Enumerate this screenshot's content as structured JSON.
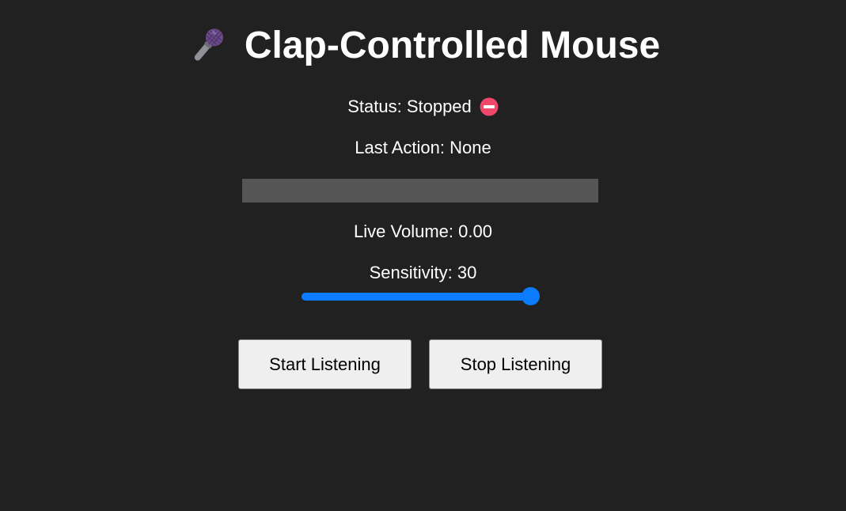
{
  "header": {
    "icon": "microphone-icon",
    "title": "Clap-Controlled Mouse"
  },
  "status": {
    "text": "Status: Stopped",
    "icon": "no-entry-icon",
    "icon_color": "#f0476b"
  },
  "last_action": {
    "text": "Last Action: None"
  },
  "volume": {
    "level": 0,
    "text": "Live Volume: 0.00"
  },
  "sensitivity": {
    "text": "Sensitivity: 30",
    "value": 30,
    "min": 0,
    "max": 30
  },
  "buttons": {
    "start_label": "Start Listening",
    "stop_label": "Stop Listening"
  },
  "colors": {
    "background": "#212121",
    "accent": "#0b7bff",
    "volume_track": "#555555"
  }
}
